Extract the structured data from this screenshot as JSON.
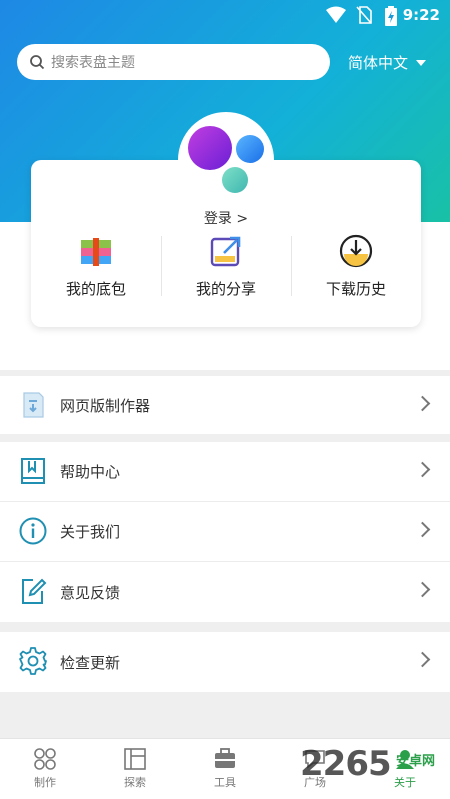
{
  "status_bar": {
    "time": "9:22"
  },
  "search": {
    "placeholder": "搜索表盘主题"
  },
  "language": {
    "selected": "简体中文"
  },
  "user_card": {
    "login_label": "登录 >",
    "shortcuts": [
      {
        "label": "我的底包",
        "icon": "package-icon"
      },
      {
        "label": "我的分享",
        "icon": "share-icon"
      },
      {
        "label": "下载历史",
        "icon": "download-history-icon"
      }
    ]
  },
  "menu": {
    "web_maker": "网页版制作器",
    "help": "帮助中心",
    "about": "关于我们",
    "feedback": "意见反馈",
    "update": "检查更新"
  },
  "tabs": [
    {
      "label": "制作",
      "icon": "grid-icon",
      "active": false
    },
    {
      "label": "探索",
      "icon": "layout-icon",
      "active": false
    },
    {
      "label": "工具",
      "icon": "toolbox-icon",
      "active": false
    },
    {
      "label": "广场",
      "icon": "forum-icon",
      "active": false
    },
    {
      "label": "关于",
      "icon": "user-icon",
      "active": true
    }
  ],
  "watermark": {
    "text": "2265",
    "suffix": "安卓网"
  },
  "colors": {
    "accent": "#1e88e5",
    "teal": "#19c1a6",
    "active_tab": "#2b9f4a"
  }
}
